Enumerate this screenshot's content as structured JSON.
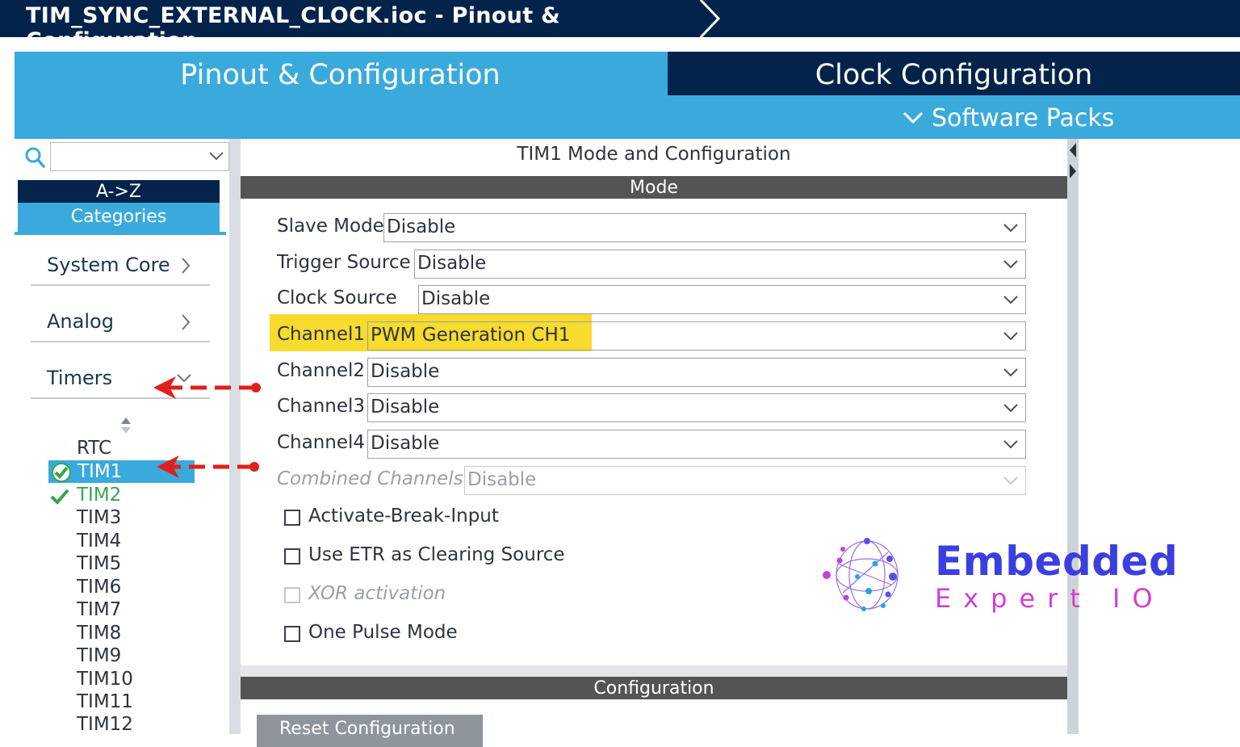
{
  "window": {
    "title": "TIM_SYNC_EXTERNAL_CLOCK.ioc - Pinout & Configuration"
  },
  "tabs": {
    "pinout": "Pinout & Configuration",
    "clock": "Clock Configuration",
    "software_packs": "Software Packs"
  },
  "sidebar": {
    "search": {
      "value": "",
      "placeholder": ""
    },
    "az_button": "A->Z",
    "categories_button": "Categories",
    "categories": [
      {
        "label": "System Core"
      },
      {
        "label": "Analog"
      },
      {
        "label": "Timers"
      }
    ],
    "timers": [
      {
        "label": "RTC",
        "state": "none"
      },
      {
        "label": "TIM1",
        "state": "selected-configured"
      },
      {
        "label": "TIM2",
        "state": "configured"
      },
      {
        "label": "TIM3",
        "state": "none"
      },
      {
        "label": "TIM4",
        "state": "none"
      },
      {
        "label": "TIM5",
        "state": "none"
      },
      {
        "label": "TIM6",
        "state": "none"
      },
      {
        "label": "TIM7",
        "state": "none"
      },
      {
        "label": "TIM8",
        "state": "none"
      },
      {
        "label": "TIM9",
        "state": "none"
      },
      {
        "label": "TIM10",
        "state": "none"
      },
      {
        "label": "TIM11",
        "state": "none"
      },
      {
        "label": "TIM12",
        "state": "none"
      }
    ]
  },
  "panel": {
    "title": "TIM1 Mode and Configuration",
    "mode_header": "Mode",
    "config_header": "Configuration",
    "reset_button": "Reset Configuration",
    "fields": [
      {
        "label": "Slave Mode",
        "value": "Disable",
        "enabled": true
      },
      {
        "label": "Trigger Source",
        "value": "Disable",
        "enabled": true
      },
      {
        "label": "Clock Source",
        "value": "Disable",
        "enabled": true
      },
      {
        "label": "Channel1",
        "value": "PWM Generation CH1",
        "enabled": true,
        "highlighted": true
      },
      {
        "label": "Channel2",
        "value": "Disable",
        "enabled": true
      },
      {
        "label": "Channel3",
        "value": "Disable",
        "enabled": true
      },
      {
        "label": "Channel4",
        "value": "Disable",
        "enabled": true
      },
      {
        "label": "Combined Channels",
        "value": "Disable",
        "enabled": false
      }
    ],
    "checkboxes": [
      {
        "label": "Activate-Break-Input",
        "checked": false,
        "enabled": true
      },
      {
        "label": "Use ETR as Clearing Source",
        "checked": false,
        "enabled": true
      },
      {
        "label": "XOR activation",
        "checked": false,
        "enabled": false
      },
      {
        "label": "One Pulse Mode",
        "checked": false,
        "enabled": true
      }
    ]
  },
  "watermark": {
    "line1": "Embedded",
    "line2": "Expert IO"
  },
  "colors": {
    "navy": "#03234b",
    "accent": "#3aaadc",
    "highlight": "#f7db2d",
    "section_bar": "#545454",
    "check_green": "#37a34c",
    "annotation_red": "#e0201a"
  }
}
